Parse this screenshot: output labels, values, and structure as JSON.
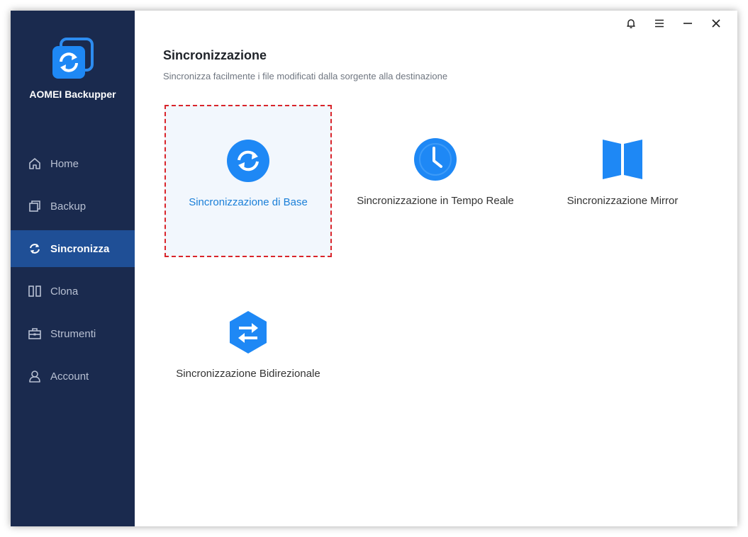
{
  "app": {
    "name": "AOMEI Backupper"
  },
  "sidebar": {
    "items": [
      {
        "label": "Home",
        "icon": "home-icon",
        "active": false
      },
      {
        "label": "Backup",
        "icon": "backup-icon",
        "active": false
      },
      {
        "label": "Sincronizza",
        "icon": "sync-icon",
        "active": true
      },
      {
        "label": "Clona",
        "icon": "clone-icon",
        "active": false
      },
      {
        "label": "Strumenti",
        "icon": "tools-icon",
        "active": false
      },
      {
        "label": "Account",
        "icon": "account-icon",
        "active": false
      }
    ]
  },
  "header": {
    "title": "Sincronizzazione",
    "subtitle": "Sincronizza facilmente i file modificati dalla sorgente alla destinazione"
  },
  "options": [
    {
      "label": "Sincronizzazione di Base",
      "icon": "basic-sync-icon",
      "selected": true
    },
    {
      "label": "Sincronizzazione in Tempo Reale",
      "icon": "clock-icon",
      "selected": false
    },
    {
      "label": "Sincronizzazione Mirror",
      "icon": "mirror-icon",
      "selected": false
    },
    {
      "label": "Sincronizzazione Bidirezionale",
      "icon": "two-way-sync-icon",
      "selected": false
    }
  ],
  "colors": {
    "sidebar_bg": "#1a2a4e",
    "sidebar_active": "#1f4f96",
    "accent_blue": "#1a7fd8",
    "selection_border": "#d9252b"
  }
}
